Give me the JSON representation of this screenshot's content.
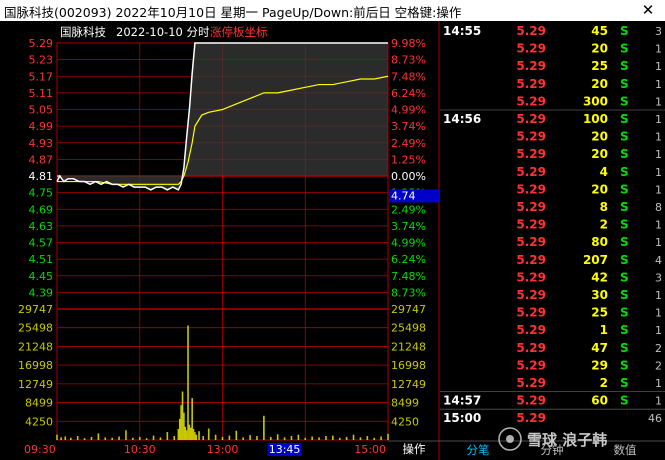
{
  "window": {
    "title": "国脉科技(002093)  2022年10月10日  星期一  PageUp/Down:前后日  空格键:操作",
    "close_icon": "close-icon"
  },
  "chart_header": {
    "stock_name": "国脉科技",
    "date_mode": "2022-10-10 分时",
    "limit_axis_label": "涨停板坐标"
  },
  "colors": {
    "up": "#ff3232",
    "down": "#00dd00",
    "flat": "#ffffff",
    "price_line": "#ffffff",
    "avg_line": "#ffff00",
    "volume": "#c8c800",
    "grid": "#b00000",
    "cursor_box": "#0000c8"
  },
  "chart_data": {
    "type": "line",
    "prev_close": 4.81,
    "price_axis": {
      "ticks": [
        "5.29",
        "5.23",
        "5.17",
        "5.11",
        "5.05",
        "4.99",
        "4.93",
        "4.87",
        "4.81",
        "4.75",
        "4.69",
        "4.63",
        "4.57",
        "4.51",
        "4.45",
        "4.39"
      ],
      "pct_ticks": [
        "9.98%",
        "8.73%",
        "7.48%",
        "6.24%",
        "4.99%",
        "3.74%",
        "2.49%",
        "1.25%",
        "0.00%",
        "1.25%",
        "2.49%",
        "3.74%",
        "4.99%",
        "6.24%",
        "7.48%",
        "8.73%"
      ],
      "ylim": [
        4.33,
        5.29
      ]
    },
    "cursor_price": "4.74",
    "volume_axis": {
      "ticks": [
        "29747",
        "25498",
        "21248",
        "16998",
        "12749",
        "8499",
        "4250"
      ],
      "ylim": [
        0,
        29747
      ]
    },
    "time_labels": [
      "09:30",
      "10:30",
      "13:00",
      "13:45",
      "15:00"
    ],
    "cursor_time": "13:45",
    "price": {
      "x": [
        0,
        2,
        5,
        8,
        12,
        16,
        20,
        24,
        28,
        32,
        36,
        40,
        44,
        48,
        52,
        56,
        60,
        64,
        68,
        72,
        76,
        80,
        84,
        88,
        90,
        92,
        94,
        96,
        98,
        100,
        104,
        110,
        120,
        135,
        150,
        165,
        180,
        195,
        210,
        225,
        240
      ],
      "y": [
        4.79,
        4.81,
        4.79,
        4.8,
        4.8,
        4.79,
        4.79,
        4.78,
        4.79,
        4.78,
        4.79,
        4.78,
        4.78,
        4.77,
        4.78,
        4.77,
        4.77,
        4.77,
        4.76,
        4.77,
        4.77,
        4.76,
        4.77,
        4.76,
        4.78,
        4.84,
        4.95,
        5.05,
        5.18,
        5.29,
        5.29,
        5.29,
        5.29,
        5.29,
        5.29,
        5.29,
        5.29,
        5.29,
        5.29,
        5.29,
        5.29
      ]
    },
    "average": {
      "x": [
        0,
        10,
        20,
        30,
        40,
        50,
        60,
        70,
        80,
        88,
        90,
        92,
        95,
        98,
        100,
        105,
        110,
        120,
        130,
        140,
        150,
        160,
        170,
        180,
        190,
        200,
        210,
        220,
        230,
        240
      ],
      "y": [
        4.79,
        4.79,
        4.79,
        4.79,
        4.78,
        4.78,
        4.78,
        4.78,
        4.78,
        4.78,
        4.79,
        4.81,
        4.86,
        4.93,
        4.99,
        5.03,
        5.04,
        5.05,
        5.07,
        5.09,
        5.11,
        5.11,
        5.12,
        5.13,
        5.14,
        5.14,
        5.15,
        5.16,
        5.16,
        5.17
      ]
    },
    "volume": {
      "x": [
        0,
        3,
        6,
        10,
        15,
        20,
        25,
        30,
        35,
        40,
        45,
        50,
        55,
        60,
        65,
        70,
        75,
        80,
        85,
        88,
        89,
        90,
        91,
        92,
        93,
        94,
        95,
        96,
        97,
        98,
        99,
        100,
        101,
        103,
        106,
        110,
        115,
        120,
        125,
        130,
        135,
        140,
        145,
        150,
        155,
        160,
        165,
        170,
        175,
        180,
        185,
        190,
        195,
        200,
        205,
        210,
        215,
        220,
        225,
        230,
        235,
        240
      ],
      "values": [
        1200,
        600,
        800,
        500,
        900,
        400,
        700,
        1500,
        600,
        500,
        800,
        2200,
        500,
        700,
        400,
        1000,
        600,
        1800,
        900,
        2500,
        4800,
        7900,
        11000,
        6200,
        3000,
        2200,
        26000,
        3500,
        2800,
        9500,
        2500,
        1800,
        1200,
        2000,
        900,
        2600,
        1200,
        700,
        1000,
        2100,
        600,
        1100,
        900,
        5500,
        700,
        1300,
        600,
        900,
        1200,
        500,
        800,
        600,
        900,
        1000,
        500,
        700,
        1200,
        600,
        900,
        500,
        800,
        1400
      ]
    }
  },
  "side_panel": {
    "times": [
      {
        "label": "14:55",
        "row": 0
      },
      {
        "label": "14:56",
        "row": 5
      },
      {
        "label": "14:57",
        "row": 21
      },
      {
        "label": "15:00",
        "row": 22
      }
    ],
    "rows": [
      {
        "price": "5.29",
        "vol": "45",
        "dir": "S",
        "n": "3"
      },
      {
        "price": "5.29",
        "vol": "20",
        "dir": "S",
        "n": "1"
      },
      {
        "price": "5.29",
        "vol": "25",
        "dir": "S",
        "n": "1"
      },
      {
        "price": "5.29",
        "vol": "20",
        "dir": "S",
        "n": "1"
      },
      {
        "price": "5.29",
        "vol": "300",
        "dir": "S",
        "n": "1"
      },
      {
        "price": "5.29",
        "vol": "100",
        "dir": "S",
        "n": "1"
      },
      {
        "price": "5.29",
        "vol": "20",
        "dir": "S",
        "n": "1"
      },
      {
        "price": "5.29",
        "vol": "20",
        "dir": "S",
        "n": "1"
      },
      {
        "price": "5.29",
        "vol": "4",
        "dir": "S",
        "n": "1"
      },
      {
        "price": "5.29",
        "vol": "20",
        "dir": "S",
        "n": "1"
      },
      {
        "price": "5.29",
        "vol": "8",
        "dir": "S",
        "n": "8"
      },
      {
        "price": "5.29",
        "vol": "2",
        "dir": "S",
        "n": "1"
      },
      {
        "price": "5.29",
        "vol": "80",
        "dir": "S",
        "n": "1"
      },
      {
        "price": "5.29",
        "vol": "207",
        "dir": "S",
        "n": "4"
      },
      {
        "price": "5.29",
        "vol": "42",
        "dir": "S",
        "n": "3"
      },
      {
        "price": "5.29",
        "vol": "30",
        "dir": "S",
        "n": "1"
      },
      {
        "price": "5.29",
        "vol": "25",
        "dir": "S",
        "n": "1"
      },
      {
        "price": "5.29",
        "vol": "1",
        "dir": "S",
        "n": "1"
      },
      {
        "price": "5.29",
        "vol": "47",
        "dir": "S",
        "n": "2"
      },
      {
        "price": "5.29",
        "vol": "29",
        "dir": "S",
        "n": "2"
      },
      {
        "price": "5.29",
        "vol": "2",
        "dir": "S",
        "n": "1"
      },
      {
        "price": "5.29",
        "vol": "60",
        "dir": "S",
        "n": "1"
      },
      {
        "price": "5.29",
        "vol": "",
        "dir": "",
        "n": "46"
      }
    ]
  },
  "bottom_tabs": {
    "operate": "操作",
    "tabs": [
      "分笔",
      "分钟",
      "数值"
    ]
  },
  "watermark": "雪球 浪子韩"
}
